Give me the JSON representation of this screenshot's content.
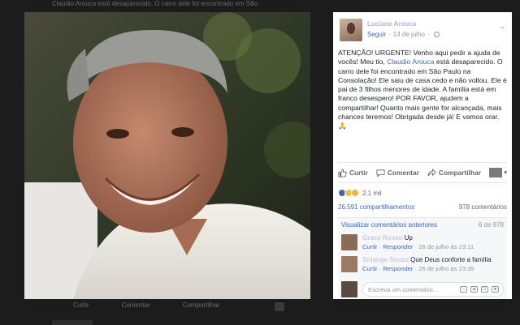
{
  "background": {
    "caption": "Claudio Arouca está desaparecido. O carro dele foi encontrado em São",
    "actions": [
      "Curtir",
      "Comentar",
      "Compartilhar"
    ]
  },
  "post": {
    "author": "Luciano Arouca",
    "follow_label": "Seguir",
    "date": "14 de julho",
    "text_before_link": "ATENÇÃO! URGENTE! Venho aqui pedir a ajuda de vocês! Meu tio, ",
    "text_link": "Claudio Arouca",
    "text_after_link": " está desaparecido. O carro dele foi encontrado em São Paulo na Consolação! Ele saiu de casa cedo e não voltou. Ele é pai de 3 filhos menores de idade. A família está em franco desespero! POR FAVOR, ajudem a compartilhar! Quanto mais gente for alcançada, mais chances teremos! Obrigada desde já! E vamos orar. 🙏",
    "actions": {
      "like": "Curtir",
      "comment": "Comentar",
      "share": "Compartilhar"
    },
    "reactions_count": "2,1 mil",
    "shares_count": "26.591 compartilhamentos",
    "comments_count": "978 comentários"
  },
  "comments": {
    "previous_link": "Visualizar comentários anteriores",
    "pager": "6 de 978",
    "items": [
      {
        "name": "Grace Rosso",
        "text": "Up",
        "like": "Curtir",
        "reply": "Responder",
        "time": "26 de julho às 23:11"
      },
      {
        "name": "Solange Souza",
        "text": "Que Deus conforte a família",
        "like": "Curtir",
        "reply": "Responder",
        "time": "26 de julho às 23:35"
      }
    ],
    "placeholder": "Escreva um comentário..."
  },
  "colors": {
    "link": "#4267b2",
    "muted": "#90949c",
    "page_bg": "#1c1c1c"
  }
}
